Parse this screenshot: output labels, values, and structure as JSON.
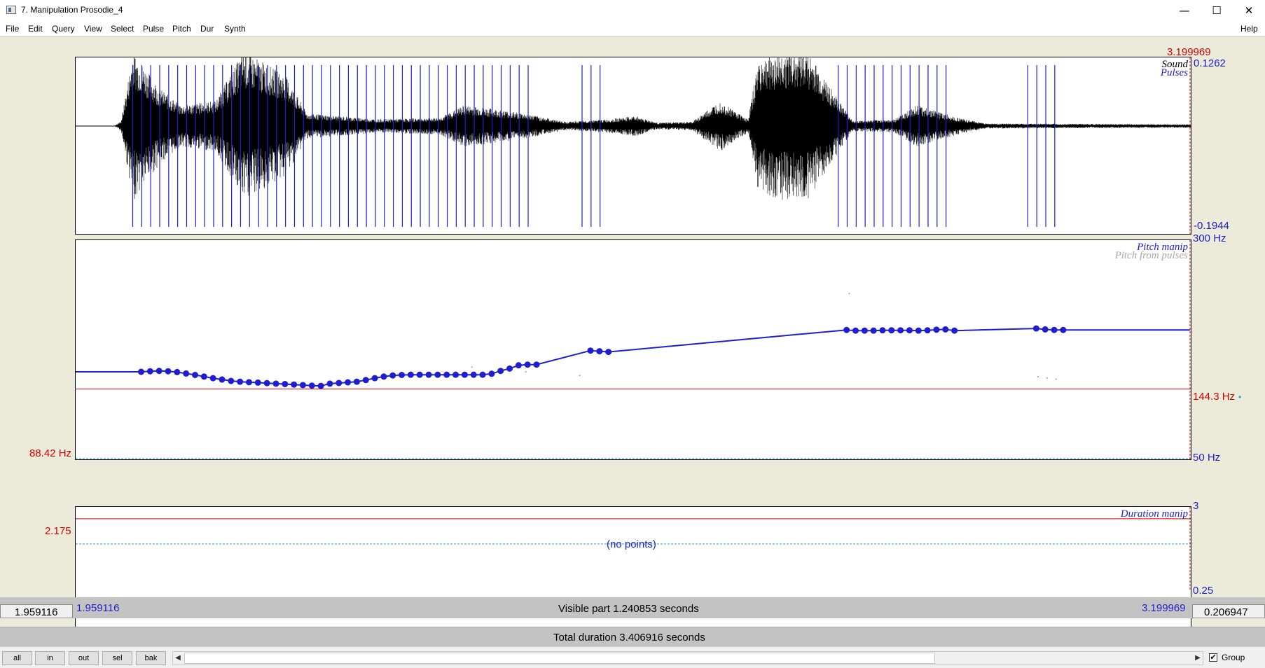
{
  "window": {
    "title": "7. Manipulation Prosodie_4",
    "controls": [
      "—",
      "☐",
      "✕"
    ]
  },
  "menu": [
    "File",
    "Edit",
    "Query",
    "View",
    "Select",
    "Pulse",
    "Pitch",
    "Dur",
    "Synth"
  ],
  "help": "Help",
  "cursor_time": "3.199969",
  "sound_panel": {
    "legend_sound": "Sound",
    "legend_pulses": "Pulses",
    "max_value": "0.1262",
    "min_value": "-0.1944",
    "pulses_in_view": true
  },
  "pitch_panel": {
    "legend_manip": "Pitch manip",
    "legend_from_pulses": "Pitch from pulses",
    "top_label": "300 Hz",
    "bottom_label": "50 Hz",
    "cursor_value": "88.42 Hz",
    "end_value": "144.3 Hz",
    "curve_units": "Hz",
    "manip_points": [
      [
        1.959,
        102
      ],
      [
        2.032,
        102
      ],
      [
        2.042,
        102.5
      ],
      [
        2.052,
        102.8
      ],
      [
        2.062,
        102.5
      ],
      [
        2.072,
        101.8
      ],
      [
        2.082,
        100.6
      ],
      [
        2.092,
        99.4
      ],
      [
        2.102,
        98.1
      ],
      [
        2.112,
        96.8
      ],
      [
        2.122,
        95.7
      ],
      [
        2.132,
        94.6
      ],
      [
        2.142,
        94.0
      ],
      [
        2.152,
        93.6
      ],
      [
        2.162,
        93.3
      ],
      [
        2.172,
        92.9
      ],
      [
        2.182,
        92.5
      ],
      [
        2.192,
        92.2
      ],
      [
        2.202,
        91.8
      ],
      [
        2.212,
        91.4
      ],
      [
        2.222,
        91.0
      ],
      [
        2.232,
        90.8
      ],
      [
        2.242,
        92.5
      ],
      [
        2.252,
        93.0
      ],
      [
        2.262,
        93.5
      ],
      [
        2.272,
        94.0
      ],
      [
        2.282,
        95.3
      ],
      [
        2.292,
        96.8
      ],
      [
        2.302,
        98.1
      ],
      [
        2.312,
        99.0
      ],
      [
        2.322,
        99.4
      ],
      [
        2.332,
        99.6
      ],
      [
        2.342,
        99.6
      ],
      [
        2.352,
        99.6
      ],
      [
        2.362,
        99.6
      ],
      [
        2.372,
        99.6
      ],
      [
        2.382,
        99.6
      ],
      [
        2.392,
        99.6
      ],
      [
        2.402,
        99.6
      ],
      [
        2.412,
        99.6
      ],
      [
        2.422,
        100.4
      ],
      [
        2.432,
        102.8
      ],
      [
        2.442,
        104.8
      ],
      [
        2.452,
        107.7
      ],
      [
        2.462,
        108.3
      ],
      [
        2.472,
        108.3
      ],
      [
        2.532,
        121.6
      ],
      [
        2.542,
        121.0
      ],
      [
        2.552,
        120.3
      ],
      [
        2.817,
        144.3
      ],
      [
        2.827,
        143.5
      ],
      [
        2.837,
        143.5
      ],
      [
        2.847,
        143.5
      ],
      [
        2.857,
        143.9
      ],
      [
        2.867,
        143.9
      ],
      [
        2.877,
        143.9
      ],
      [
        2.887,
        143.9
      ],
      [
        2.897,
        143.5
      ],
      [
        2.907,
        143.9
      ],
      [
        2.917,
        144.6
      ],
      [
        2.927,
        145.0
      ],
      [
        2.937,
        143.5
      ],
      [
        3.028,
        146.1
      ],
      [
        3.038,
        145.0
      ],
      [
        3.048,
        144.3
      ],
      [
        3.058,
        144.3
      ],
      [
        3.199,
        144.3
      ]
    ]
  },
  "duration_panel": {
    "legend": "Duration manip",
    "top_label": "3",
    "bottom_label": "0.25",
    "cursor_value": "2.175",
    "empty_text": "(no points)"
  },
  "time_axis": {
    "start": "1.959116",
    "end": "3.199969",
    "visible_text": "Visible part 1.240853 seconds",
    "left_outside": "1.959116",
    "right_outside": "0.206947",
    "total_text": "Total duration 3.406916 seconds"
  },
  "buttons": [
    "all",
    "in",
    "out",
    "sel",
    "bak"
  ],
  "group_label": "Group",
  "group_checked": true,
  "colors": {
    "pulse": "#1e1ed0",
    "pitch": "#1e1ed0",
    "cursor": "#d00000",
    "wave": "#000000",
    "bg": "#ecebd9"
  }
}
